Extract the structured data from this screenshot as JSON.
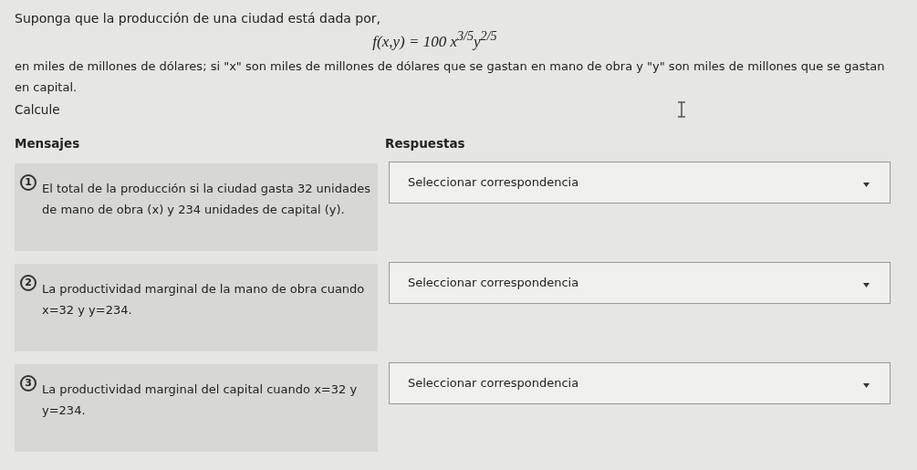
{
  "intro": "Suponga que la producción de una ciudad está dada por,",
  "formula": "f(x,y) = 100 x$^{3/5}$y$^{2/5}$",
  "description": "en miles de millones de dólares; si \"x\" son miles de millones de dólares que se gastan en mano de obra y \"y\" son miles de millones que se gastan en capital.",
  "instruction": "Calcule",
  "headers": {
    "messages": "Mensajes",
    "answers": "Respuestas"
  },
  "items": [
    {
      "number": "1",
      "message": "El total de la producción si la ciudad gasta 32 unidades de mano de obra (x) y 234 unidades de capital (y).",
      "answer": "Seleccionar correspondencia"
    },
    {
      "number": "2",
      "message": "La productividad marginal de la mano de obra cuando x=32 y y=234.",
      "answer": "Seleccionar correspondencia"
    },
    {
      "number": "3",
      "message": "La productividad marginal del capital cuando x=32 y y=234.",
      "answer": "Seleccionar correspondencia"
    }
  ]
}
